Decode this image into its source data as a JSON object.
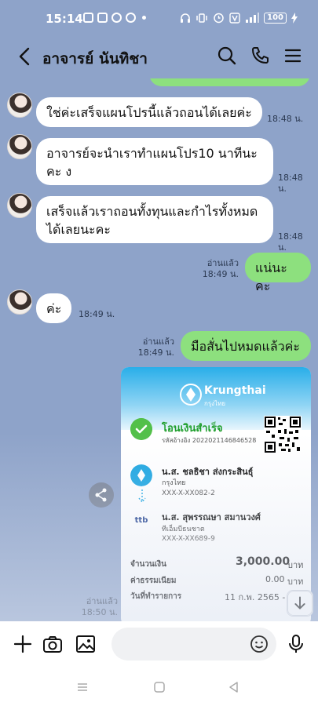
{
  "status": {
    "time": "15:14",
    "left_icons": [
      "square-app-icon",
      "camera-app-icon",
      "messenger-icon",
      "facebook-icon",
      "dot-icon"
    ],
    "right_icons": [
      "headphones-icon",
      "vibrate-icon",
      "alarm-icon",
      "volte-icon",
      "signal-icon"
    ],
    "battery": "100"
  },
  "header": {
    "title": "อาจารย์ นันทิชา",
    "back_icon": "chevron-left-icon",
    "search_icon": "search-icon",
    "call_icon": "phone-icon",
    "menu_icon": "menu-icon"
  },
  "messages": [
    {
      "side": "in",
      "text": "ใช่ค่ะเสร็จแผนโปรนี้แล้วถอนได้เลยค่ะ",
      "time": "18:48 น."
    },
    {
      "side": "in",
      "text": "อาจารย์จะนำเราทำแผนโปร10 นาทีนะคะ ง",
      "time": "18:48 น."
    },
    {
      "side": "in",
      "text": "เสร็จแล้วเราถอนทั้งทุนและกำไรทั้งหมดได้เลยนะคะ",
      "time": "18:48 น."
    },
    {
      "side": "out",
      "text": "แน่นะคะ",
      "read": "อ่านแล้ว",
      "time": "18:49 น."
    },
    {
      "side": "in",
      "text": "ค่ะ",
      "time": "18:49 น."
    },
    {
      "side": "out",
      "text": "มือสั่นไปหมดแล้วค่ะ",
      "read": "อ่านแล้ว",
      "time": "18:49 น."
    }
  ],
  "slip": {
    "bank_name": "Krungthai",
    "bank_name_th": "กรุงไทย",
    "status": "โอนเงินสำเร็จ",
    "ref": "รหัสอ้างอิง 2022021146846528",
    "sender": {
      "name": "น.ส. ชลธิชา ส่งกระสินธุ์",
      "bank": "กรุงไทย",
      "account": "XXX-X-XX082-2"
    },
    "receiver": {
      "name": "น.ส. สุพรรณษา สมานวงศ์",
      "bank": "ทีเอ็มบีธนชาต",
      "account": "XXX-X-XX689-9"
    },
    "amount_label": "จำนวนเงิน",
    "amount": "3,000.00",
    "currency": "บาท",
    "fee_label": "ค่าธรรมเนียม",
    "fee": "0.00",
    "date_label": "วันที่ทำรายการ",
    "date": "11 ก.พ. 2565 - 18",
    "read": "อ่านแล้ว",
    "time": "18:50 น."
  },
  "input": {
    "placeholder": "",
    "plus_icon": "plus-icon",
    "camera_icon": "camera-icon",
    "image_icon": "image-icon",
    "emoji_icon": "emoji-icon",
    "mic_icon": "microphone-icon"
  },
  "colors": {
    "chat_bg": "#8ea3c9",
    "outgoing": "#8de07e",
    "incoming": "#ffffff",
    "success_green": "#1e9e2c"
  }
}
